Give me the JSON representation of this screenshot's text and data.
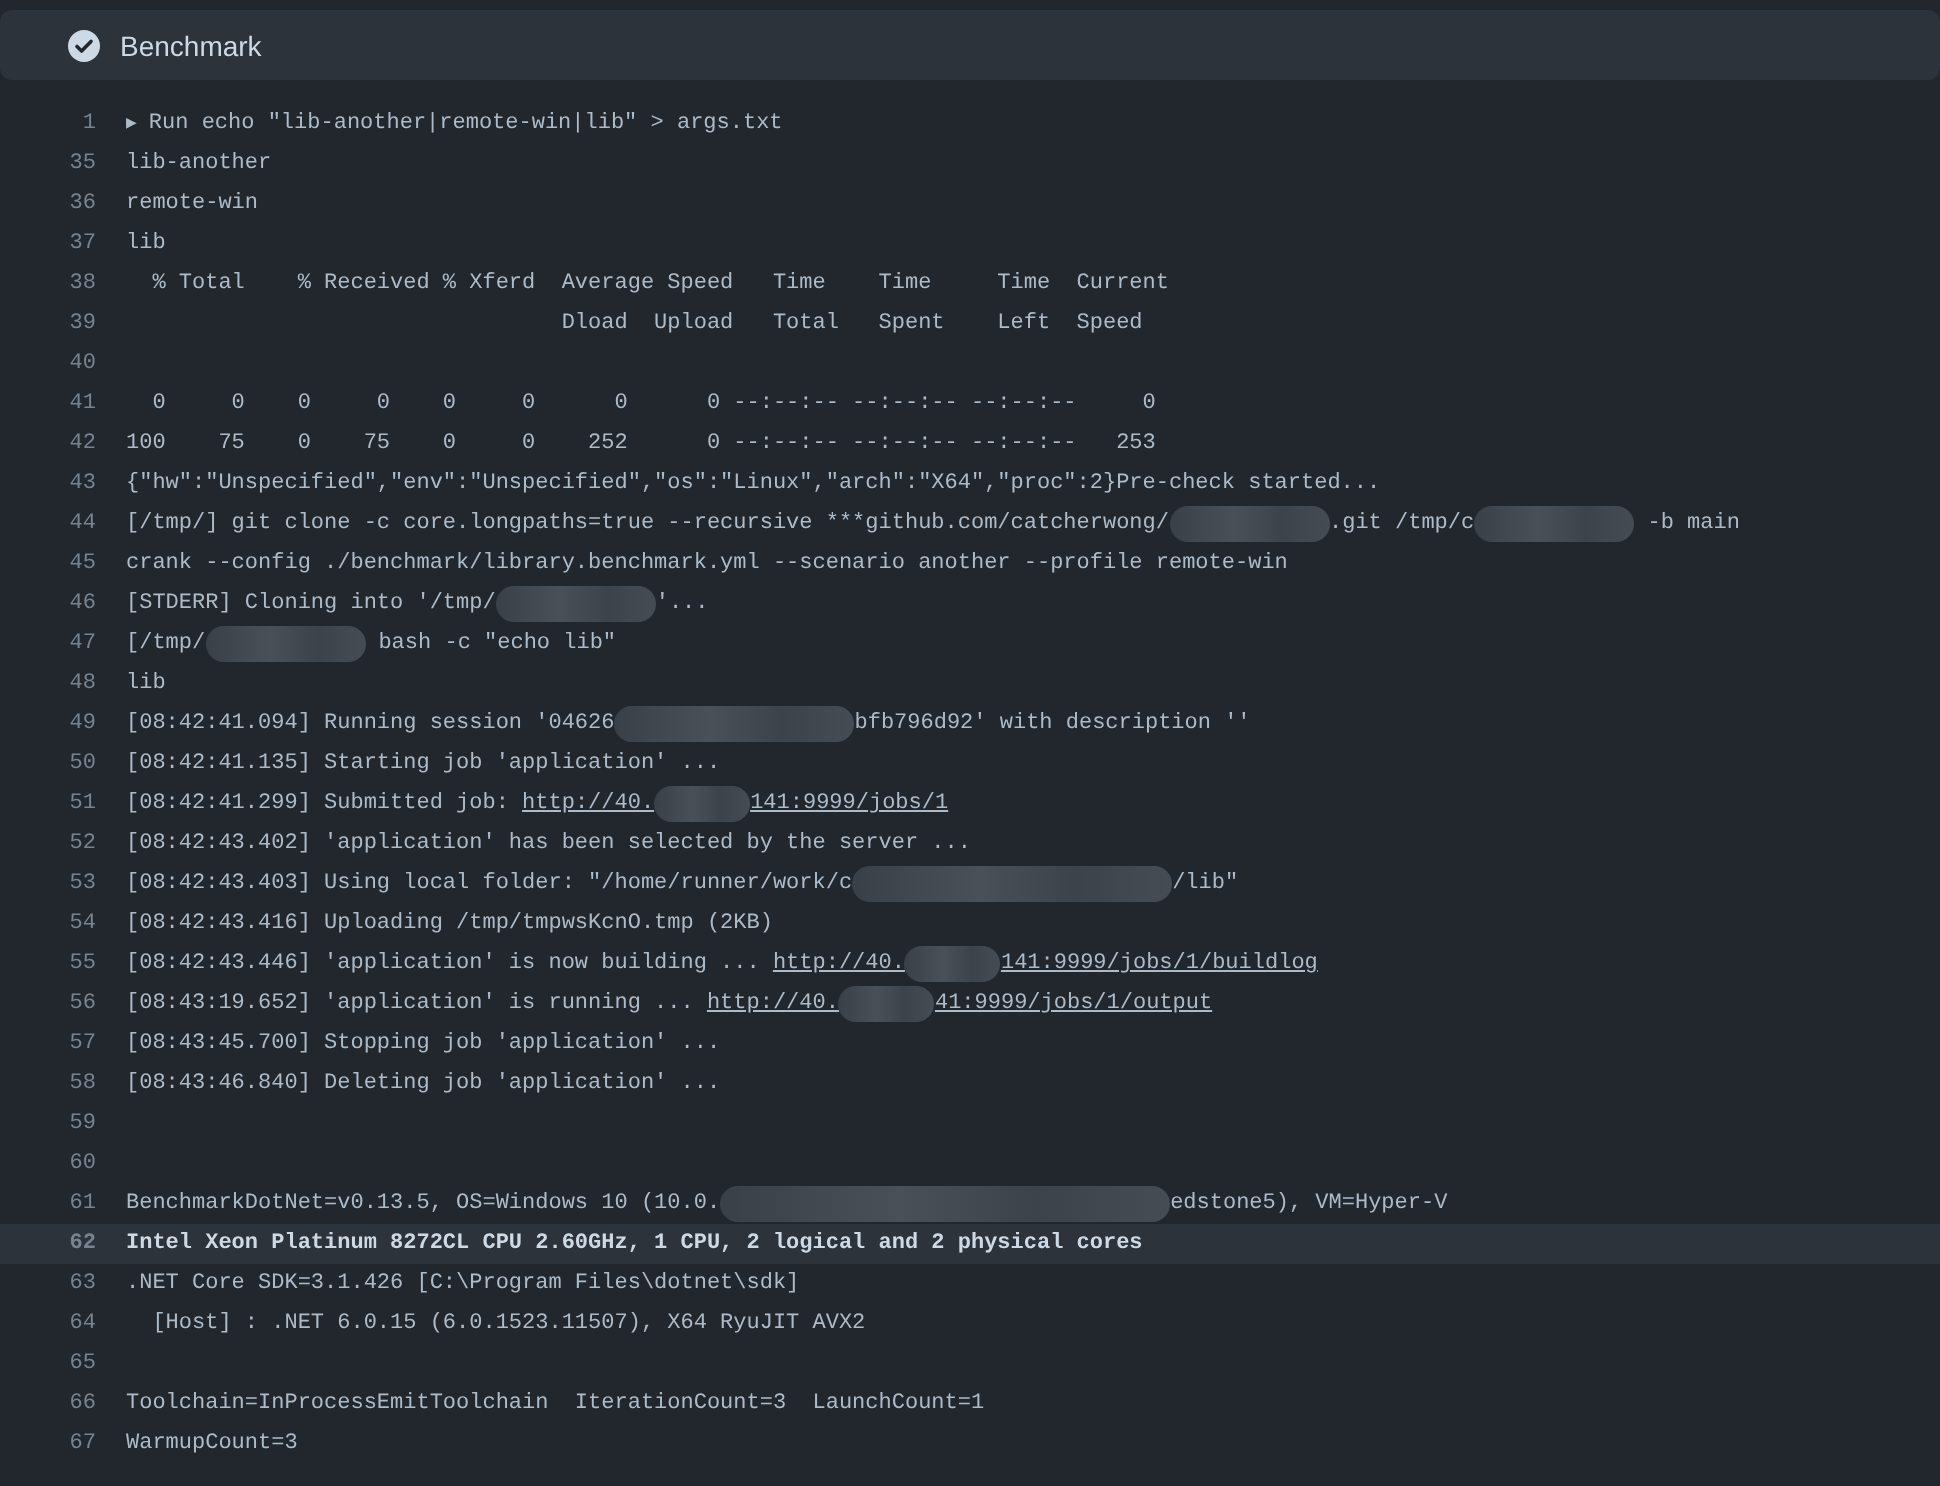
{
  "step": {
    "title": "Benchmark"
  },
  "lines": [
    {
      "number": "1",
      "selected": false,
      "toggle": "▶",
      "segments": [
        {
          "kind": "text",
          "text": "Run echo \"lib-another|remote-win|lib\" > args.txt"
        }
      ]
    },
    {
      "number": "35",
      "selected": false,
      "segments": [
        {
          "kind": "text",
          "text": "lib-another"
        }
      ]
    },
    {
      "number": "36",
      "selected": false,
      "segments": [
        {
          "kind": "text",
          "text": "remote-win"
        }
      ]
    },
    {
      "number": "37",
      "selected": false,
      "segments": [
        {
          "kind": "text",
          "text": "lib"
        }
      ]
    },
    {
      "number": "38",
      "selected": false,
      "segments": [
        {
          "kind": "text",
          "text": "  % Total    % Received % Xferd  Average Speed   Time    Time     Time  Current"
        }
      ]
    },
    {
      "number": "39",
      "selected": false,
      "segments": [
        {
          "kind": "text",
          "text": "                                 Dload  Upload   Total   Spent    Left  Speed"
        }
      ]
    },
    {
      "number": "40",
      "selected": false
    },
    {
      "number": "41",
      "selected": false,
      "segments": [
        {
          "kind": "text",
          "text": "  0     0    0     0    0     0      0      0 --:--:-- --:--:-- --:--:--     0"
        }
      ]
    },
    {
      "number": "42",
      "selected": false,
      "segments": [
        {
          "kind": "text",
          "text": "100    75    0    75    0     0    252      0 --:--:-- --:--:-- --:--:--   253"
        }
      ]
    },
    {
      "number": "43",
      "selected": false,
      "segments": [
        {
          "kind": "text",
          "text": "{\"hw\":\"Unspecified\",\"env\":\"Unspecified\",\"os\":\"Linux\",\"arch\":\"X64\",\"proc\":2}Pre-check started..."
        }
      ]
    },
    {
      "number": "44",
      "selected": false,
      "segments": [
        {
          "kind": "text",
          "text": "[/tmp/] git clone -c core.longpaths=true --recursive ***github.com/catcherwong/"
        },
        {
          "kind": "blur-medium"
        },
        {
          "kind": "text",
          "text": ".git /tmp/c"
        },
        {
          "kind": "blur-medium"
        },
        {
          "kind": "text",
          "text": " -b main"
        }
      ]
    },
    {
      "number": "45",
      "selected": false,
      "segments": [
        {
          "kind": "text",
          "text": "crank --config ./benchmark/library.benchmark.yml --scenario another --profile remote-win"
        }
      ]
    },
    {
      "number": "46",
      "selected": false,
      "segments": [
        {
          "kind": "text",
          "text": "[STDERR] Cloning into '/tmp/"
        },
        {
          "kind": "blur-medium"
        },
        {
          "kind": "text",
          "text": "'..."
        }
      ]
    },
    {
      "number": "47",
      "selected": false,
      "segments": [
        {
          "kind": "text",
          "text": "[/tmp/"
        },
        {
          "kind": "blur-medium"
        },
        {
          "kind": "text",
          "text": " bash -c \"echo lib\""
        }
      ]
    },
    {
      "number": "48",
      "selected": false,
      "segments": [
        {
          "kind": "text",
          "text": "lib"
        }
      ]
    },
    {
      "number": "49",
      "selected": false,
      "segments": [
        {
          "kind": "text",
          "text": "[08:42:41.094] Running session '04626"
        },
        {
          "kind": "blur-long"
        },
        {
          "kind": "text",
          "text": "bfb796d92' with description ''"
        }
      ]
    },
    {
      "number": "50",
      "selected": false,
      "segments": [
        {
          "kind": "text",
          "text": "[08:42:41.135] Starting job 'application' ..."
        }
      ]
    },
    {
      "number": "51",
      "selected": false,
      "segments": [
        {
          "kind": "text",
          "text": "[08:42:41.299] Submitted job: "
        },
        {
          "kind": "link",
          "text": "http://40."
        },
        {
          "kind": "blur-short"
        },
        {
          "kind": "link",
          "text": "141:9999/jobs/1"
        }
      ]
    },
    {
      "number": "52",
      "selected": false,
      "segments": [
        {
          "kind": "text",
          "text": "[08:42:43.402] 'application' has been selected by the server ..."
        }
      ]
    },
    {
      "number": "53",
      "selected": false,
      "segments": [
        {
          "kind": "text",
          "text": "[08:42:43.403] Using local folder: \"/home/runner/work/c"
        },
        {
          "kind": "blur-wide"
        },
        {
          "kind": "text",
          "text": "/lib\""
        }
      ]
    },
    {
      "number": "54",
      "selected": false,
      "segments": [
        {
          "kind": "text",
          "text": "[08:42:43.416] Uploading /tmp/tmpwsKcnO.tmp (2KB)"
        }
      ]
    },
    {
      "number": "55",
      "selected": false,
      "segments": [
        {
          "kind": "text",
          "text": "[08:42:43.446] 'application' is now building ... "
        },
        {
          "kind": "link",
          "text": "http://40."
        },
        {
          "kind": "blur-short"
        },
        {
          "kind": "link",
          "text": "141:9999/jobs/1/buildlog"
        }
      ]
    },
    {
      "number": "56",
      "selected": false,
      "segments": [
        {
          "kind": "text",
          "text": "[08:43:19.652] 'application' is running ... "
        },
        {
          "kind": "link",
          "text": "http://40."
        },
        {
          "kind": "blur-short"
        },
        {
          "kind": "link",
          "text": "41:9999/jobs/1/output"
        }
      ]
    },
    {
      "number": "57",
      "selected": false,
      "segments": [
        {
          "kind": "text",
          "text": "[08:43:45.700] Stopping job 'application' ..."
        }
      ]
    },
    {
      "number": "58",
      "selected": false,
      "segments": [
        {
          "kind": "text",
          "text": "[08:43:46.840] Deleting job 'application' ..."
        }
      ]
    },
    {
      "number": "59",
      "selected": false
    },
    {
      "number": "60",
      "selected": false
    },
    {
      "number": "61",
      "selected": false,
      "segments": [
        {
          "kind": "text",
          "text": "BenchmarkDotNet=v0.13.5, OS=Windows 10 (10.0."
        },
        {
          "kind": "blur-widest"
        },
        {
          "kind": "text",
          "text": "edstone5), VM=Hyper-V"
        }
      ]
    },
    {
      "number": "62",
      "selected": true,
      "segments": [
        {
          "kind": "text",
          "text": "Intel Xeon Platinum 8272CL CPU 2.60GHz, 1 CPU, 2 logical and 2 physical cores"
        }
      ]
    },
    {
      "number": "63",
      "selected": false,
      "segments": [
        {
          "kind": "text",
          "text": ".NET Core SDK=3.1.426 [C:\\Program Files\\dotnet\\sdk]"
        }
      ]
    },
    {
      "number": "64",
      "selected": false,
      "segments": [
        {
          "kind": "text",
          "text": "  [Host] : .NET 6.0.15 (6.0.1523.11507), X64 RyuJIT AVX2"
        }
      ]
    },
    {
      "number": "65",
      "selected": false
    },
    {
      "number": "66",
      "selected": false,
      "segments": [
        {
          "kind": "text",
          "text": "Toolchain=InProcessEmitToolchain  IterationCount=3  LaunchCount=1"
        }
      ]
    },
    {
      "number": "67",
      "selected": false,
      "segments": [
        {
          "kind": "text",
          "text": "WarmupCount=3"
        }
      ]
    }
  ]
}
